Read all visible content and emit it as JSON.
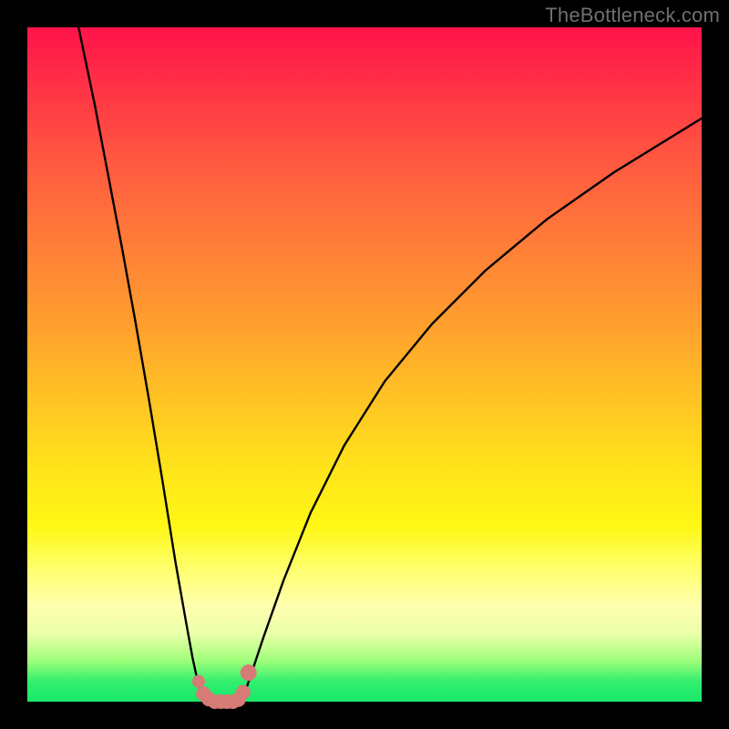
{
  "watermark": "TheBottleneck.com",
  "colors": {
    "frame": "#000000",
    "curve": "#000000",
    "marker": "#d77b76"
  },
  "chart_data": {
    "type": "line",
    "title": "",
    "xlabel": "",
    "ylabel": "",
    "xlim": [
      0,
      100
    ],
    "ylim": [
      0,
      100
    ],
    "note": "Values are bottleneck percentage (y, 0=good/green, 100=bad/red) vs an implicit horizontal parameter (x, 0-100). Estimated from pixel positions; chart has no numeric axis labels.",
    "series": [
      {
        "name": "left-branch",
        "x": [
          7.6,
          10,
          12,
          14,
          16,
          18,
          20,
          22,
          23.5,
          24.5,
          25.2,
          25.8,
          26.3
        ],
        "y": [
          100,
          88.5,
          78,
          67.5,
          56.5,
          45,
          33,
          20.5,
          12,
          6.5,
          3.3,
          1.3,
          0
        ]
      },
      {
        "name": "valley-floor",
        "x": [
          26.3,
          27,
          28,
          29,
          30,
          31,
          31.8
        ],
        "y": [
          0,
          0,
          0,
          0,
          0,
          0,
          0
        ]
      },
      {
        "name": "right-branch",
        "x": [
          31.8,
          33,
          35,
          38,
          42,
          47,
          53,
          60,
          68,
          77,
          87,
          100
        ],
        "y": [
          0,
          3.5,
          9.5,
          18,
          28,
          38,
          47.5,
          56,
          64,
          71.5,
          78.5,
          86.5
        ]
      }
    ],
    "markers": {
      "name": "highlighted-points",
      "x": [
        25.4,
        26.1,
        26.9,
        27.8,
        28.7,
        29.6,
        30.5,
        31.3,
        32.0,
        32.8
      ],
      "y": [
        3.0,
        1.2,
        0.4,
        0.0,
        0.0,
        0.0,
        0.0,
        0.3,
        1.4,
        4.3
      ],
      "r": [
        7,
        8,
        8,
        8,
        8,
        8,
        8,
        8,
        8,
        9
      ]
    }
  }
}
